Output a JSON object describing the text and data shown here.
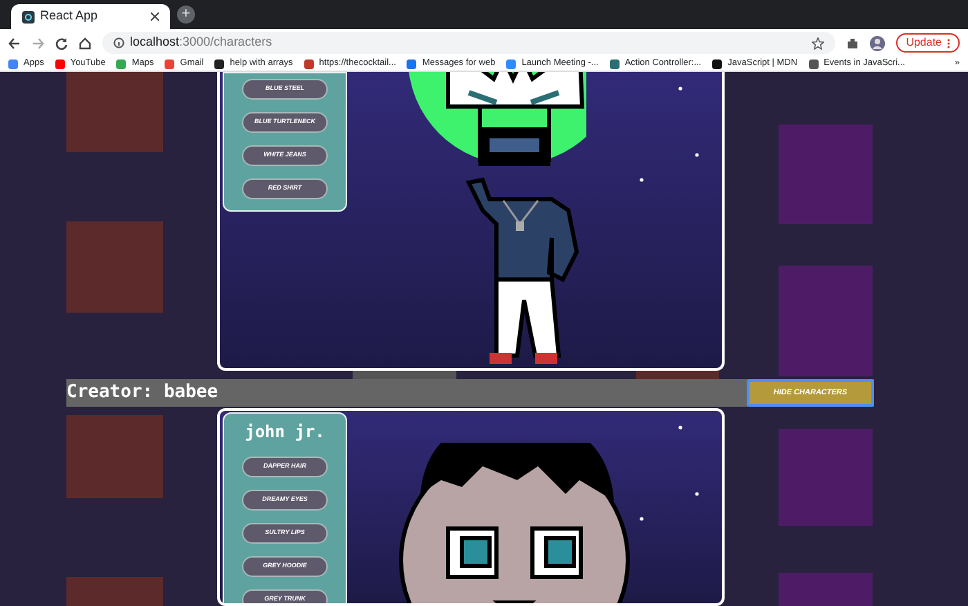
{
  "browser": {
    "tab_title": "React App",
    "new_tab": "+",
    "url_host": "localhost",
    "url_path": ":3000/characters",
    "update_label": "Update",
    "bookmarks": [
      {
        "label": "Apps",
        "color": "#4285f4"
      },
      {
        "label": "YouTube",
        "color": "#ff0000"
      },
      {
        "label": "Maps",
        "color": "#34a853"
      },
      {
        "label": "Gmail",
        "color": "#ea4335"
      },
      {
        "label": "help with arrays",
        "color": "#222222"
      },
      {
        "label": "https://thecocktail...",
        "color": "#c0392b"
      },
      {
        "label": "Messages for web",
        "color": "#1a73e8"
      },
      {
        "label": "Launch Meeting -...",
        "color": "#2d8cff"
      },
      {
        "label": "Action Controller:...",
        "color": "#2a6f73"
      },
      {
        "label": "JavaScript | MDN",
        "color": "#111111"
      },
      {
        "label": "Events in JavaScri...",
        "color": "#555555"
      }
    ],
    "more": "»"
  },
  "sections": [
    {
      "kind": "character",
      "figure": {
        "kind": "alien"
      },
      "items": [
        "BLUE STEEL",
        "BLUE TURTLENECK",
        "WHITE JEANS",
        "RED SHIRT"
      ]
    },
    {
      "kind": "creator",
      "label": "Creator: babee",
      "button": "HIDE CHARACTERS"
    },
    {
      "kind": "character",
      "figure": {
        "kind": "human"
      },
      "name": "john jr.",
      "items": [
        "DAPPER HAIR",
        "DREAMY EYES",
        "SULTRY LIPS",
        "GREY HOODIE",
        "GREY TRUNK"
      ]
    }
  ]
}
